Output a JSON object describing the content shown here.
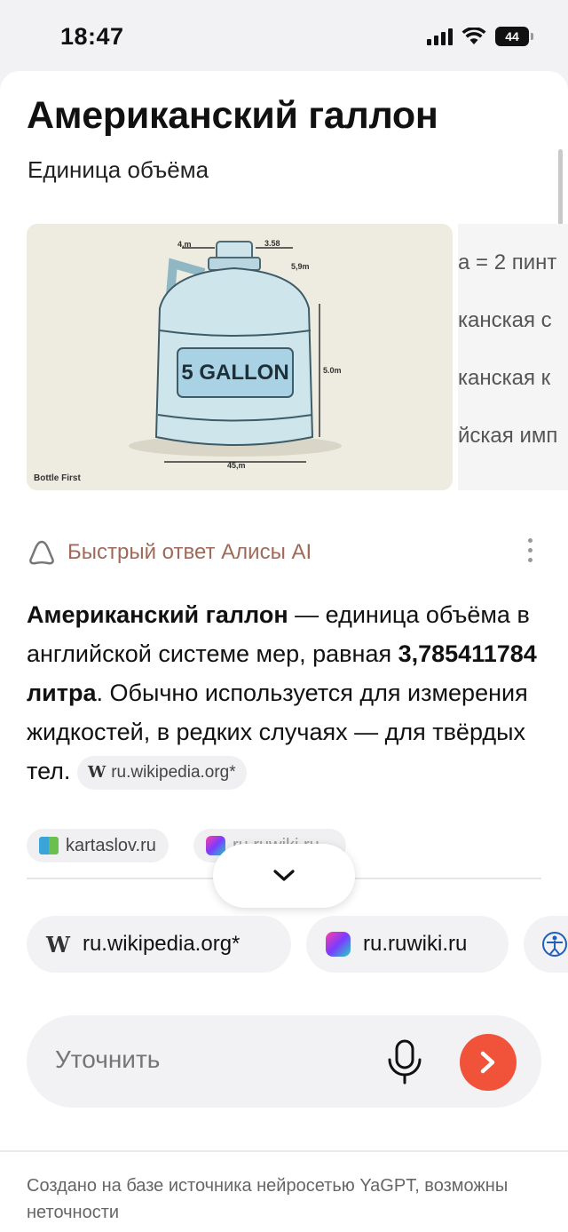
{
  "status_bar": {
    "time": "18:47",
    "battery": "44"
  },
  "header": {
    "title": "Американский галлон",
    "subtitle": "Единица объёма"
  },
  "images": {
    "main_caption": "Bottle First",
    "jug_label": "5 GALLON",
    "dim_labels": [
      "4,m",
      "3.58",
      "5,9m",
      "5.0m",
      "45,m"
    ],
    "second_lines": [
      "а = 2 пинт",
      "канская с",
      "канская к",
      "йская имп"
    ]
  },
  "alisa": {
    "label": "Быстрый ответ Алисы AI"
  },
  "answer": {
    "term": "Американский галлон",
    "part1": " — единица объёма в английской системе мер, равная ",
    "value": "3,785411784 литра",
    "part2": ". Обычно используется для измерения жидкостей, в редких случаях — для твёрдых тел."
  },
  "inline_sources": [
    {
      "name": "ru.wikipedia.org*",
      "icon": "wikipedia-icon"
    },
    {
      "name": "kartaslov.ru",
      "icon": "book-icon"
    },
    {
      "name": "ru.ruwiki.ru",
      "icon": "ruwiki-icon"
    }
  ],
  "sources": [
    {
      "name": "ru.wikipedia.org*",
      "icon": "wikipedia-icon"
    },
    {
      "name": "ru.ruwiki.ru",
      "icon": "ruwiki-icon"
    },
    {
      "name": "",
      "icon": "vitruvian-icon"
    }
  ],
  "input": {
    "placeholder": "Уточнить"
  },
  "footer": {
    "note": "Создано на базе источника нейросетью YaGPT, возможны неточности"
  },
  "colors": {
    "accent": "#f0533a",
    "alisa_label": "#a06a5a"
  }
}
